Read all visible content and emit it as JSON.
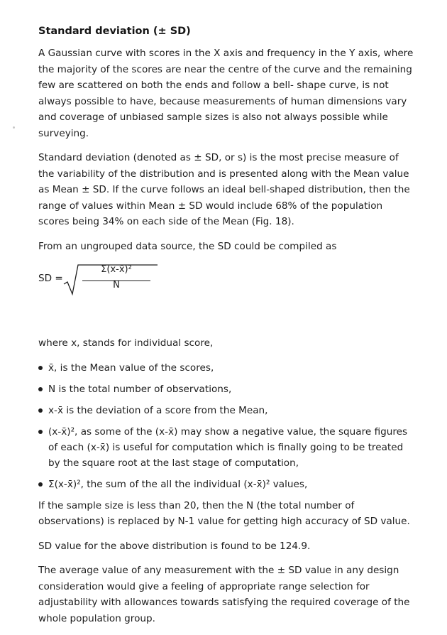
{
  "heading": "Standard deviation (± SD)",
  "paragraphs": {
    "p1": "A Gaussian curve with scores in the X axis and frequency in the Y axis, where the majority of the scores are near the centre of the curve and the remaining few are scattered on both the ends and follow a bell- shape curve, is not always possible to have, because measurements of human dimensions vary and coverage of unbiased sample sizes is also not always possible while surveying.",
    "p2": "Standard deviation (denoted as ± SD, or s) is the most precise measure of the variability of the distribution and is presented along with the Mean value as Mean ± SD. If the curve follows an ideal bell-shaped distribution, then the range of values within Mean ± SD would include 68% of the population scores being 34% on each side of the Mean (Fig. 18).",
    "p3": "From an ungrouped data source, the SD could be compiled as",
    "p4": "where x, stands for individual score,",
    "p5": "If the sample size is less than 20, then the N (the total number of observations) is replaced by N-1 value for getting high accuracy of SD value.",
    "p6": "SD value for the above distribution is found to be 124.9.",
    "p7": "The average value of any measurement with the ± SD value in any design consideration would give a feeling of appropriate range selection for adjustability with allowances towards satisfying the required coverage of the whole population group."
  },
  "formula": {
    "lhs": "SD =",
    "numerator": "Σ(x-x̄)²",
    "denominator": "N"
  },
  "bullets": [
    "x̄, is the Mean value of the scores,",
    "N is the total number of observations,",
    "x-x̄ is the deviation of a score from the Mean,",
    "(x-x̄)², as some of the (x-x̄) may show a negative value, the square figures of each (x-x̄) is useful for computation which is finally going to be treated by the square root at the last stage of computation,",
    "Σ(x-x̄)², the sum of the all the individual (x-x̄)² values,"
  ]
}
